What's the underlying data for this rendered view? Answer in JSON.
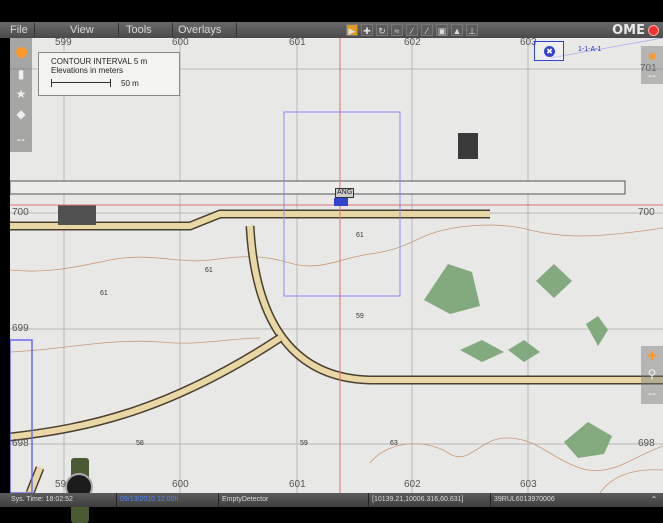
{
  "menu": {
    "items": [
      {
        "label": "File"
      },
      {
        "label": "View"
      },
      {
        "label": "Tools"
      },
      {
        "label": "Overlays"
      }
    ]
  },
  "brand": {
    "label": "OME"
  },
  "map": {
    "grid_x_labels": [
      "599",
      "600",
      "601",
      "602",
      "603"
    ],
    "grid_y_labels": [
      "701",
      "700",
      "699",
      "698"
    ],
    "legend": {
      "line1": "CONTOUR INTERVAL 5 m",
      "line2": "Elevations in meters",
      "scale_label": "50 m"
    },
    "elevation_labels": [
      "61",
      "61",
      "61",
      "59",
      "58",
      "59",
      "63"
    ],
    "unit": {
      "label": "1-1-A-1",
      "tag": "ANG"
    }
  },
  "status": {
    "sys_time": "Sys. Time: 18:02:52",
    "date_time": "09/13/2010 12:00h",
    "detector": "EmptyDetector",
    "coords": "[10139.21,10006.316,60.631]",
    "grid_ref": "39RUL6013970006"
  },
  "colors": {
    "accent_orange": "#ff9a2a",
    "unit_blue": "#3344cc",
    "road_fill": "#e9d8a6",
    "vegetation": "#7ea779",
    "status_blue": "#4d88ff"
  },
  "icons": {
    "tools": [
      "select-arrow-icon",
      "pan-icon",
      "rotate-icon",
      "measure-icon",
      "draw-icon",
      "line-icon",
      "layers-icon",
      "terrain-icon",
      "export-icon"
    ],
    "left": [
      "orange-circle-icon",
      "bar-chart-icon",
      "star-icon",
      "layers-icon",
      "resize-icon"
    ],
    "right_top": [
      "folder-icon",
      "resize-icon"
    ],
    "right_bottom": [
      "add-icon",
      "search-icon",
      "resize-icon"
    ]
  }
}
